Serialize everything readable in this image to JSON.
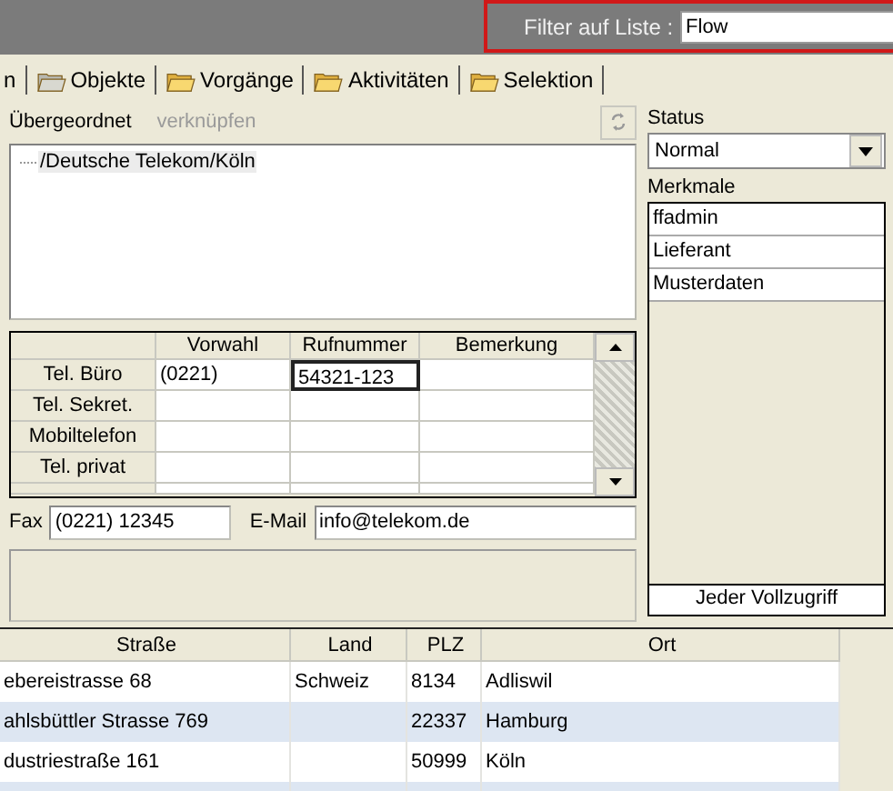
{
  "filter": {
    "label": "Filter auf Liste :",
    "value": "Flow"
  },
  "tabs": [
    {
      "label": "n",
      "kind": "plain"
    },
    {
      "label": "Objekte",
      "kind": "folder",
      "muted": true
    },
    {
      "label": "Vorgänge",
      "kind": "folder",
      "muted": false
    },
    {
      "label": "Aktivitäten",
      "kind": "folder",
      "muted": false
    },
    {
      "label": "Selektion",
      "kind": "folder",
      "muted": false
    }
  ],
  "parent": {
    "label": "Übergeordnet",
    "link": {
      "label": "verknüpfen",
      "disabled": true
    },
    "tree": [
      "/Deutsche Telekom/Köln"
    ]
  },
  "phones": {
    "columns": [
      "Vorwahl",
      "Rufnummer",
      "Bemerkung"
    ],
    "rows": [
      {
        "label": "Tel. Büro",
        "cells": [
          {
            "text": "(0221)",
            "focused": false
          },
          {
            "text": "54321-123",
            "focused": true
          },
          {
            "focused": false
          }
        ]
      },
      {
        "label": "Tel. Sekret.",
        "cells": [
          {
            "focused": false
          },
          {
            "focused": false
          },
          {
            "focused": false
          }
        ]
      },
      {
        "label": "Mobiltelefon",
        "cells": [
          {
            "focused": false
          },
          {
            "focused": false
          },
          {
            "focused": false
          }
        ]
      },
      {
        "label": "Tel. privat",
        "cells": [
          {
            "focused": false
          },
          {
            "focused": false
          },
          {
            "focused": false
          }
        ]
      }
    ]
  },
  "fax": {
    "label": "Fax",
    "value": "(0221) 12345"
  },
  "email": {
    "label": "E-Mail",
    "value": "info@telekom.de"
  },
  "status": {
    "label": "Status",
    "value": "Normal"
  },
  "features": {
    "label": "Merkmale",
    "items": [
      "ffadmin",
      "Lieferant",
      "Musterdaten"
    ],
    "footer": "Jeder Vollzugriff"
  },
  "addresses": {
    "columns": [
      "Straße",
      "Land",
      "PLZ",
      "Ort"
    ],
    "rows": [
      {
        "cells": [
          "ebereistrasse 68",
          "Schweiz",
          "8134",
          "Adliswil"
        ],
        "selected": false
      },
      {
        "cells": [
          "ahlsbüttler Strasse 769",
          "",
          "22337",
          "Hamburg"
        ],
        "selected": true
      },
      {
        "cells": [
          "dustriestraße 161",
          "",
          "50999",
          "Köln"
        ],
        "selected": false
      }
    ]
  }
}
